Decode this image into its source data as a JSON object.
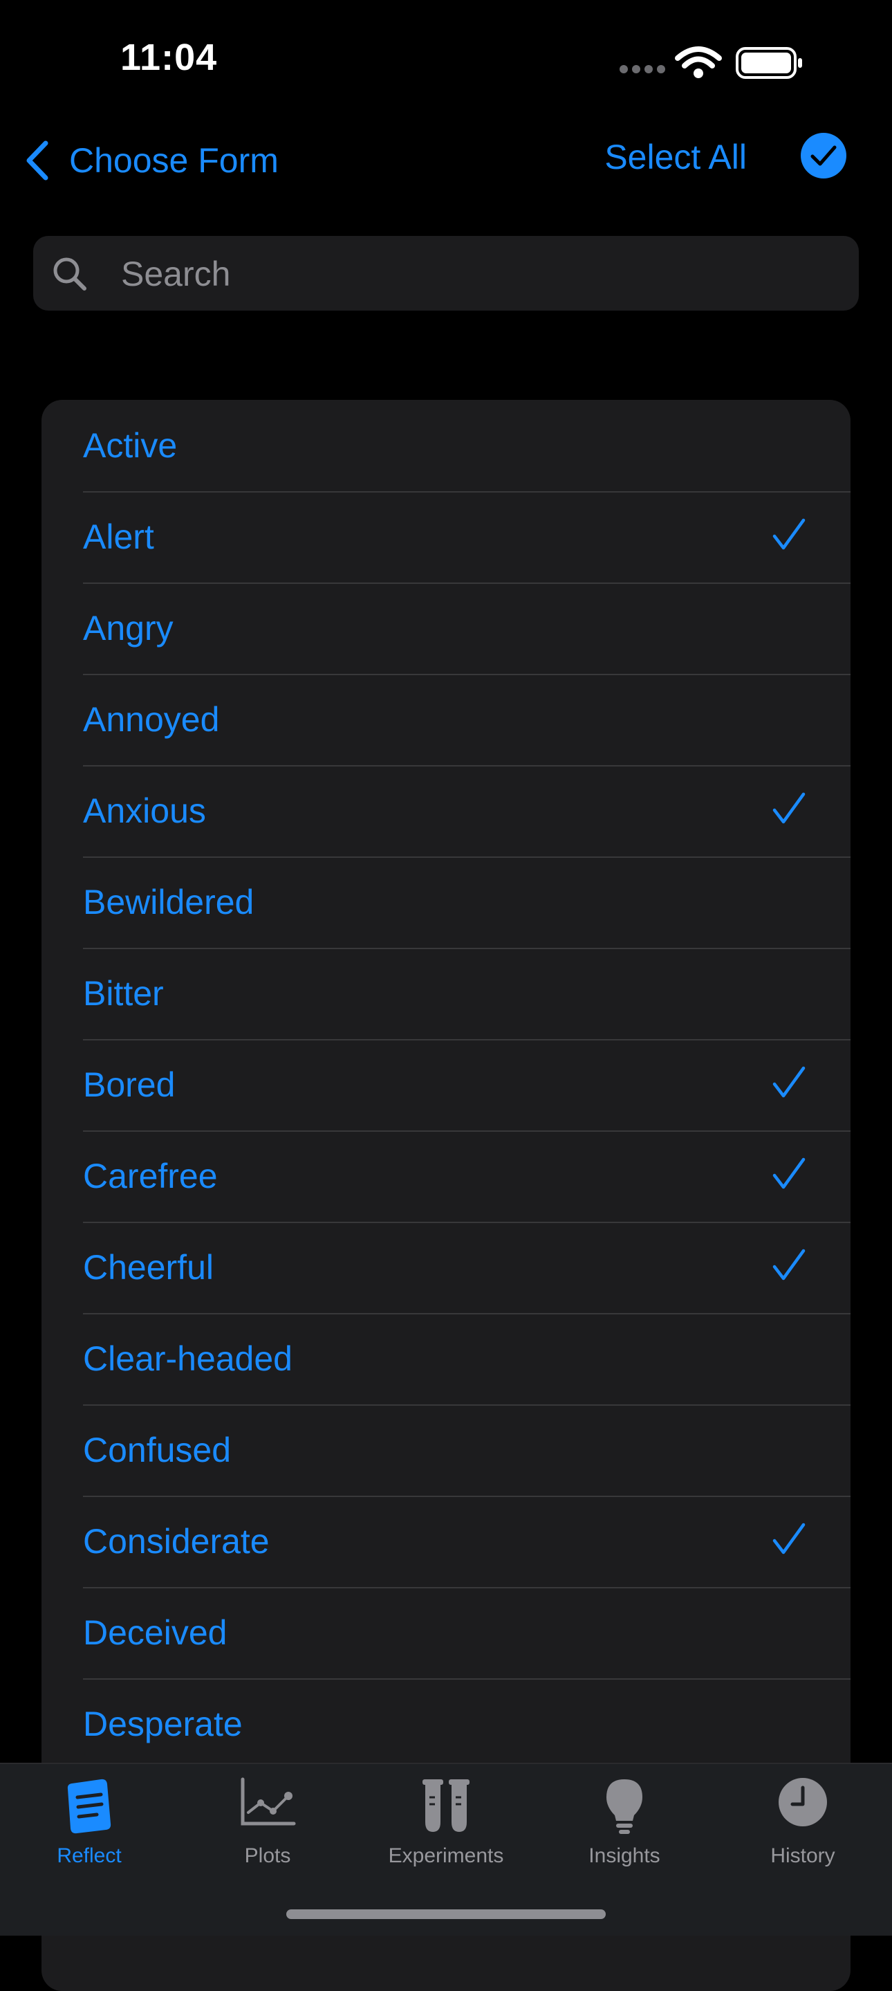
{
  "status_bar": {
    "time": "11:04"
  },
  "nav": {
    "back_label": "Choose Form",
    "select_all_label": "Select All"
  },
  "search": {
    "placeholder": "Search",
    "value": ""
  },
  "items": [
    {
      "label": "Active",
      "checked": false
    },
    {
      "label": "Alert",
      "checked": true
    },
    {
      "label": "Angry",
      "checked": false
    },
    {
      "label": "Annoyed",
      "checked": false
    },
    {
      "label": "Anxious",
      "checked": true
    },
    {
      "label": "Bewildered",
      "checked": false
    },
    {
      "label": "Bitter",
      "checked": false
    },
    {
      "label": "Bored",
      "checked": true
    },
    {
      "label": "Carefree",
      "checked": true
    },
    {
      "label": "Cheerful",
      "checked": true
    },
    {
      "label": "Clear-headed",
      "checked": false
    },
    {
      "label": "Confused",
      "checked": false
    },
    {
      "label": "Considerate",
      "checked": true
    },
    {
      "label": "Deceived",
      "checked": false
    },
    {
      "label": "Desperate",
      "checked": false
    }
  ],
  "tabs": [
    {
      "label": "Reflect",
      "icon": "document-icon",
      "active": true
    },
    {
      "label": "Plots",
      "icon": "line-chart-icon",
      "active": false
    },
    {
      "label": "Experiments",
      "icon": "test-tubes-icon",
      "active": false
    },
    {
      "label": "Insights",
      "icon": "lightbulb-icon",
      "active": false
    },
    {
      "label": "History",
      "icon": "clock-icon",
      "active": false
    }
  ],
  "colors": {
    "accent": "#1a8bff",
    "background": "#000000",
    "card": "#1c1c1e",
    "inactive": "#98989d"
  }
}
